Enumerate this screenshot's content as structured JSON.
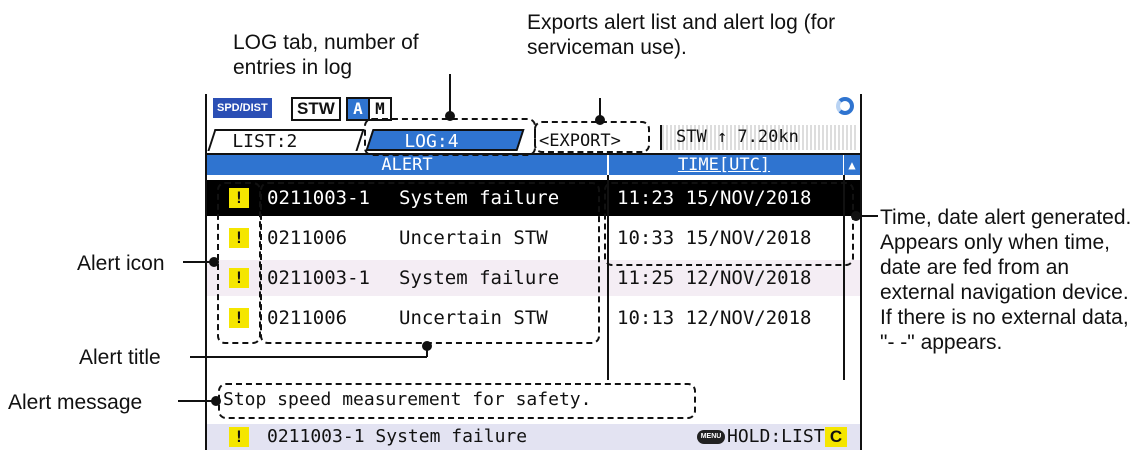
{
  "callouts": {
    "log_tab": "LOG tab, number of entries in log",
    "export": "Exports alert list and alert log (for serviceman use).",
    "alert_icon": "Alert icon",
    "alert_title": "Alert title",
    "alert_message": "Alert message",
    "time_date": "Time, date alert generated. Appears only when time, date are fed from an external navigation device. If there is no external data, \"- -\" appears."
  },
  "status": {
    "spd_dist": "SPD/DIST",
    "stw": "STW",
    "mode_a": "A",
    "mode_m": "M"
  },
  "tabs": {
    "list": "LIST:2",
    "log": "LOG:4",
    "export": "<EXPORT>",
    "speed": "STW ↑ 7.20kn"
  },
  "table": {
    "header_alert": "ALERT",
    "header_time": "TIME[UTC]",
    "rows": [
      {
        "icon": "!",
        "code": "0211003-1",
        "title": "System failure",
        "time": "11:23 15/NOV/2018"
      },
      {
        "icon": "!",
        "code": "0211006",
        "title": "Uncertain STW",
        "time": "10:33 15/NOV/2018"
      },
      {
        "icon": "!",
        "code": "0211003-1",
        "title": "System failure",
        "time": "11:25 12/NOV/2018"
      },
      {
        "icon": "!",
        "code": "0211006",
        "title": "Uncertain STW",
        "time": "10:13 12/NOV/2018"
      }
    ]
  },
  "message": "Stop speed measurement for safety.",
  "footer": {
    "icon": "!",
    "code": "0211003-1",
    "title": "System failure",
    "menu": "MENU",
    "hold": "HOLD:LIST",
    "c": "C"
  },
  "colors": {
    "accent_blue": "#2f74d0",
    "alert_yellow": "#f5e600",
    "selected_row": "#000000"
  }
}
